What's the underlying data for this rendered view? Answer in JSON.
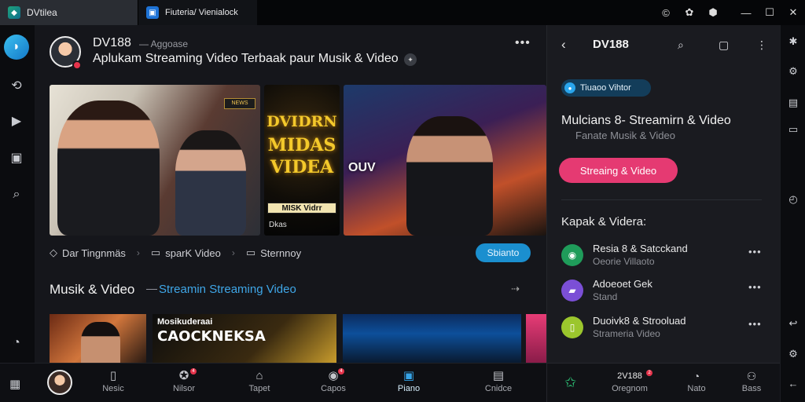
{
  "titlebar": {
    "tabs": [
      {
        "label": "DVtilea",
        "icon": "app-logo-icon"
      },
      {
        "label": "Fiuteria/ Vienialock",
        "icon": "page-icon"
      }
    ],
    "controls": [
      "extensions-icon",
      "translate-icon",
      "shield-icon",
      "minimize-icon",
      "maximize-icon",
      "close-icon"
    ]
  },
  "channel": {
    "name": "DV188",
    "sub": "— Aggoase",
    "title": "Aplukam Streaming Video Terbaak paur Musik & Video"
  },
  "thumbnails": {
    "t2_lines": [
      "DVIDRN",
      "MIDAS",
      "VIDEA"
    ],
    "t2_small": "MISK Vidrr",
    "t2_corner": "Dkas",
    "t3_badge": "OUV",
    "t1_badge": "NEWS"
  },
  "actions": {
    "items": [
      "Dar Tingnmäs",
      "sparK Video",
      "Sternnoy"
    ],
    "button": "Sbianto"
  },
  "section": {
    "title": "Musik & Video",
    "dash": "—",
    "link": "Streamin Streaming Video",
    "arrow": "⇢"
  },
  "row_thumbs": {
    "rt2_title": "Mosikuderaai",
    "rt2_sub": "CAOCKNEKSA"
  },
  "bottomnav": {
    "items": [
      {
        "label": "Nesic",
        "icon": "music-icon"
      },
      {
        "label": "Nilsor",
        "icon": "user-icon",
        "badge": "4"
      },
      {
        "label": "Tapet",
        "icon": "home-icon"
      },
      {
        "label": "Capos",
        "icon": "disc-icon",
        "badge": "4"
      },
      {
        "label": "Piano",
        "icon": "grid-icon"
      },
      {
        "label": "Cnidce",
        "icon": "library-icon"
      }
    ]
  },
  "panel": {
    "title": "DV188",
    "chip": "Tiuaoo Vihtor",
    "headline": "Mulcians 8- Streamirn & Video",
    "sub": "Fanate Musik & Video",
    "cta": "Streaing & Video",
    "section": "Kapak & Videra:",
    "rows": [
      {
        "title": "Resia 8 & Satcckand",
        "sub": "Oeorie Villaoto",
        "color": "#1f9c5a"
      },
      {
        "title": "Adoeoet Gek",
        "sub": "Stand",
        "color": "#7b4fd6"
      },
      {
        "title": "Duoivk8 & Strooluad",
        "sub": "Strameria Video",
        "color": "#9bc62d"
      }
    ],
    "nav": [
      {
        "label": "Oregnom",
        "title": "2V188",
        "badge": "2"
      },
      {
        "label": "Nato",
        "icon": "clock-icon"
      },
      {
        "label": "Bass",
        "icon": "person-icon"
      }
    ]
  },
  "colors": {
    "accent_blue": "#1b8fcf",
    "accent_pink": "#e53a72",
    "background": "#15161b"
  }
}
